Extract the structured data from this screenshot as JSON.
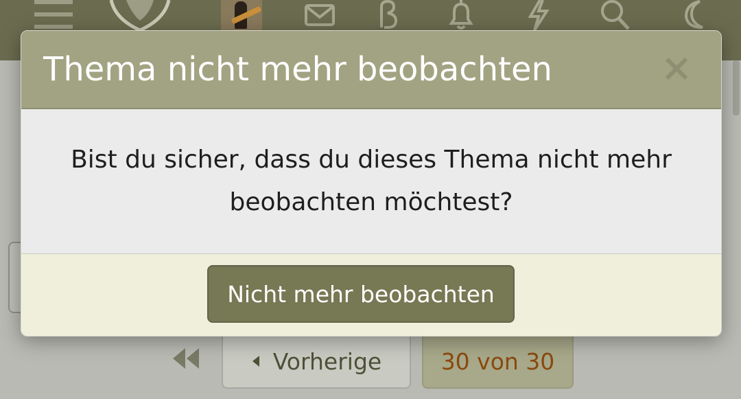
{
  "header": {
    "icons": [
      "menu-icon",
      "logo-icon",
      "avatar",
      "mail-icon",
      "beta-icon",
      "bell-icon",
      "bolt-icon",
      "search-icon",
      "moon-icon"
    ],
    "color": "#6b6c4f"
  },
  "modal": {
    "title": "Thema nicht mehr beobachten",
    "close_label": "×",
    "message": "Bist du sicher, dass du dieses Thema nicht mehr beobachten möchtest?",
    "confirm_label": "Nicht mehr beobachten",
    "header_color": "#a2a382",
    "button_color": "#777854"
  },
  "pagination": {
    "previous_label": "Vorherige",
    "page_status": "30 von 30"
  }
}
